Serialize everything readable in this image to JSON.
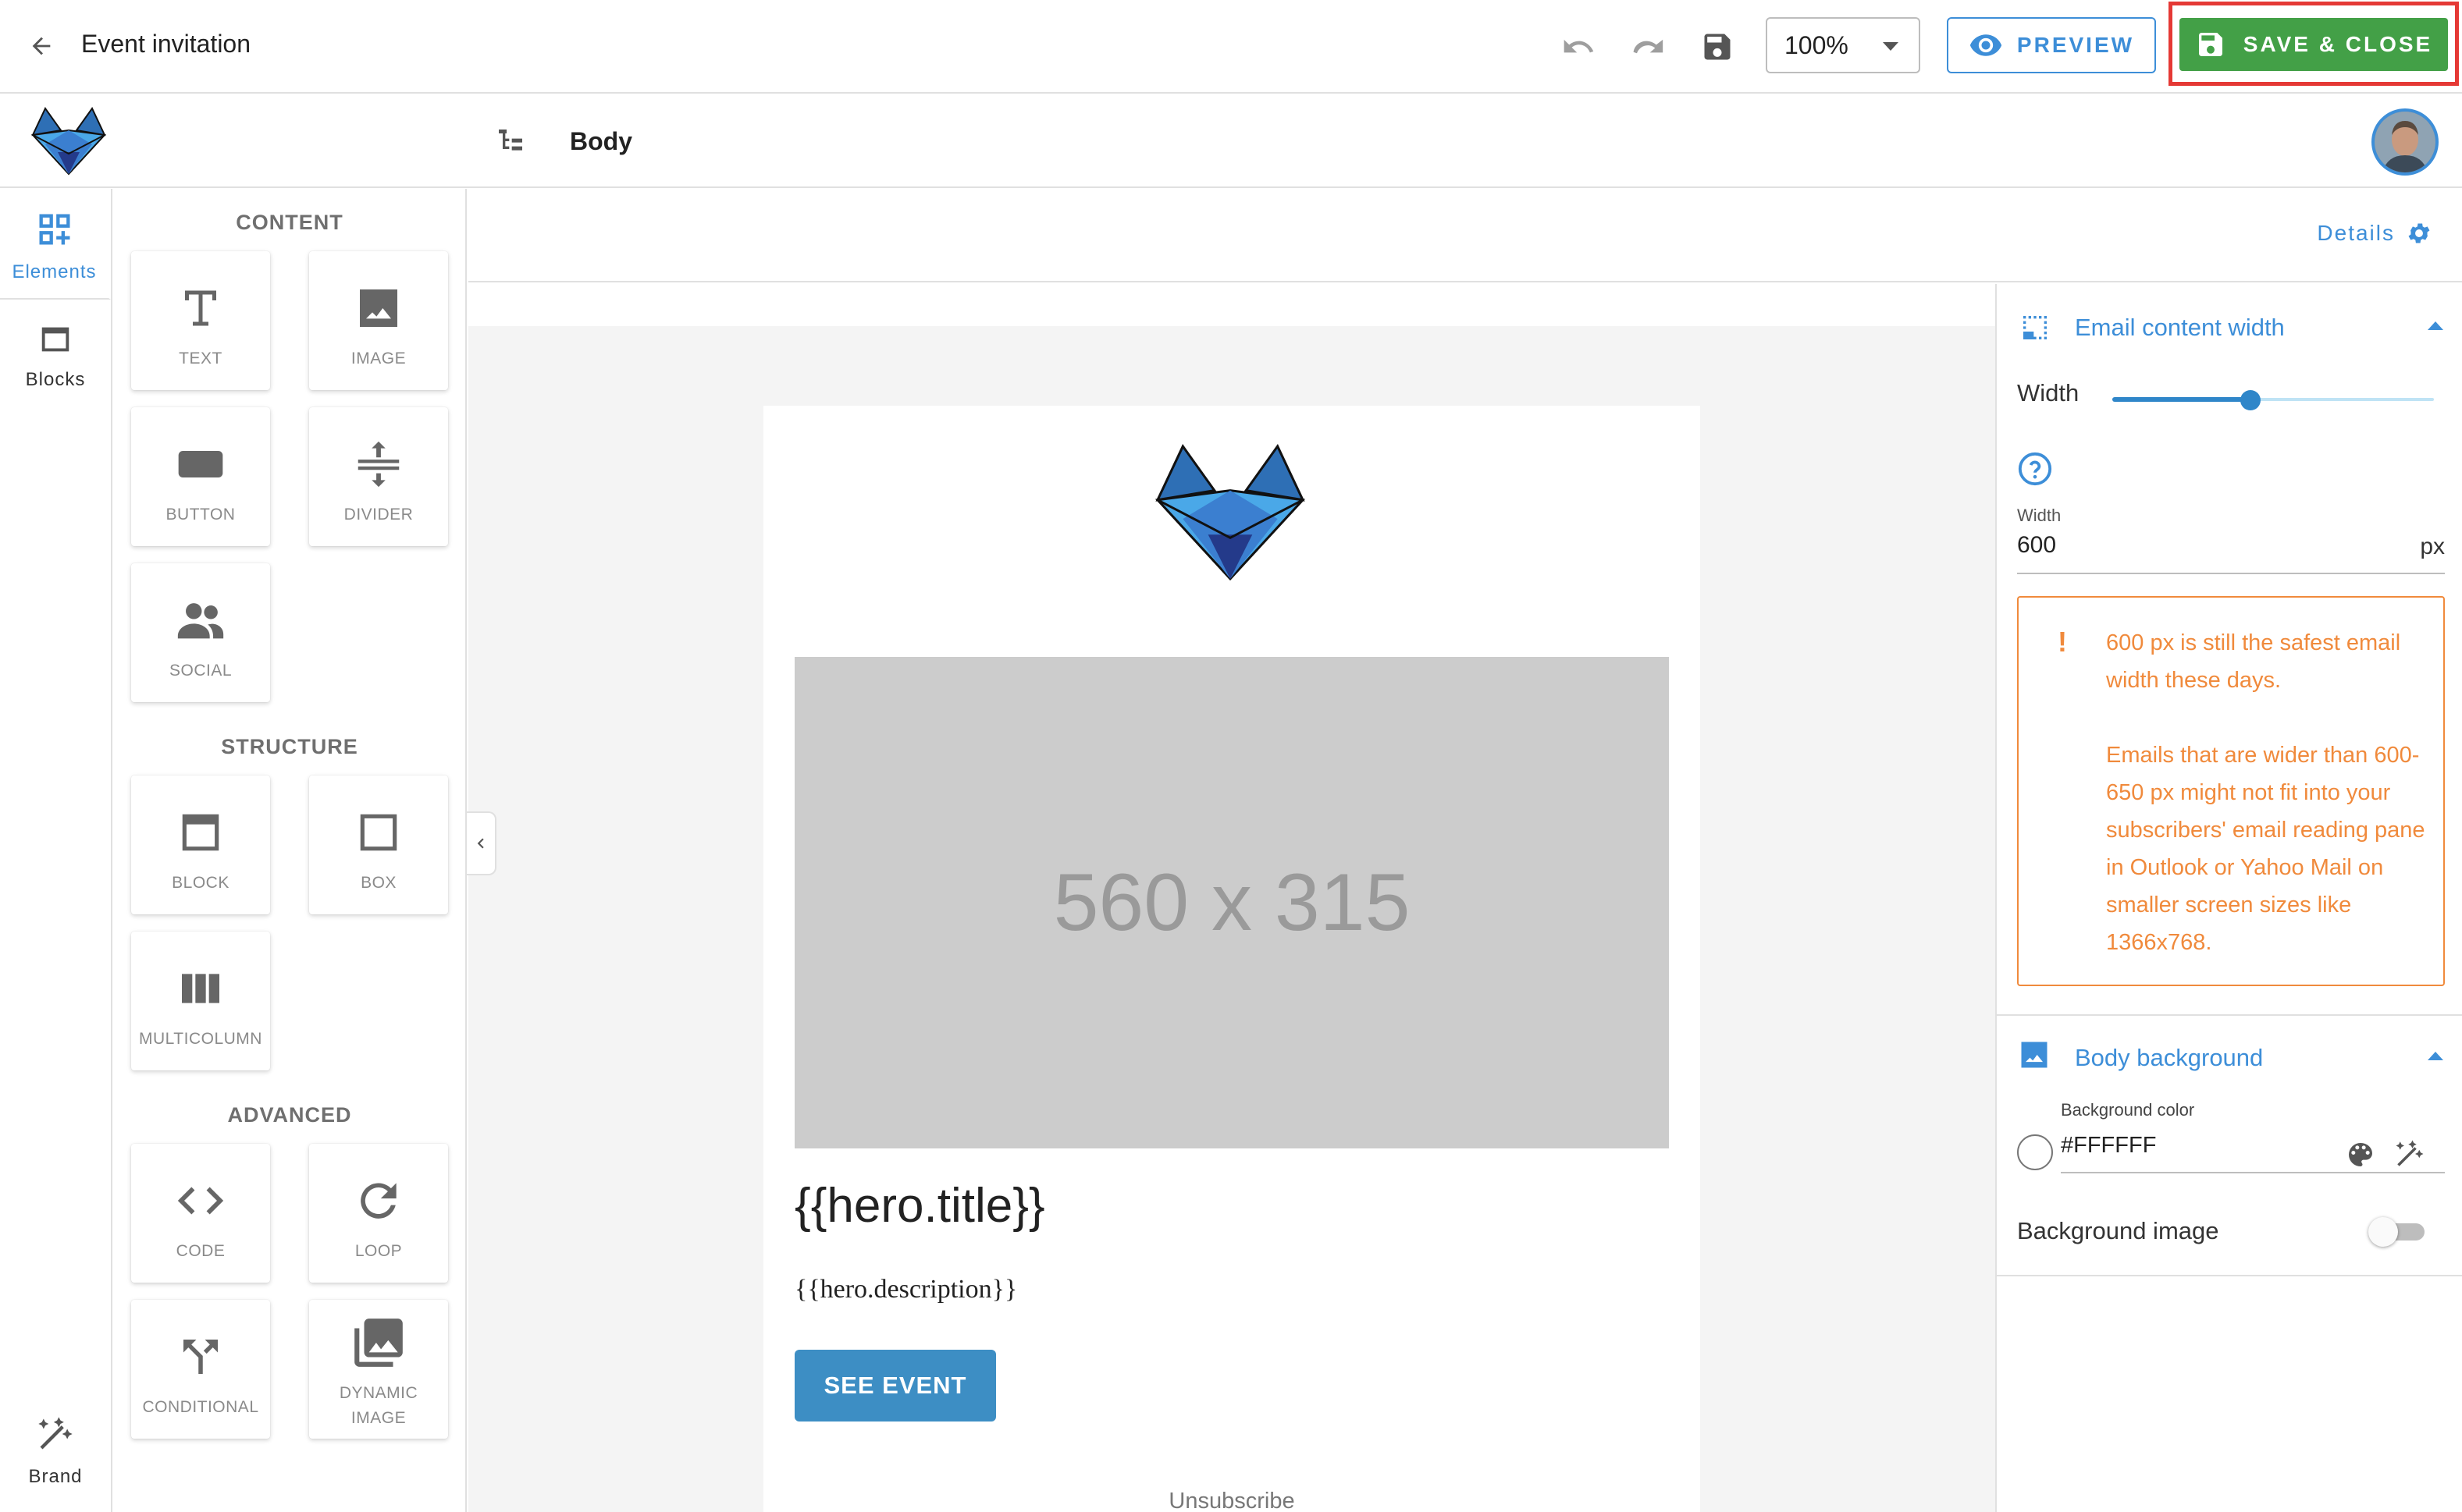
{
  "topbar": {
    "title": "Event invitation",
    "zoom": "100%",
    "preview_label": "PREVIEW",
    "save_close_label": "SAVE & CLOSE",
    "colors": {
      "accent": "#3d8ed8",
      "save": "#43a047",
      "highlight": "#e53935"
    }
  },
  "subbar": {
    "breadcrumb": "Body"
  },
  "rail": {
    "tabs": [
      {
        "label": "Elements",
        "icon": "dashboard-add-icon",
        "active": true
      },
      {
        "label": "Blocks",
        "icon": "block-icon",
        "active": false
      },
      {
        "label": "Brand",
        "icon": "magic-wand-icon",
        "active": false
      }
    ]
  },
  "panel": {
    "sections": [
      {
        "title": "CONTENT",
        "items": [
          "TEXT",
          "IMAGE",
          "BUTTON",
          "DIVIDER",
          "SOCIAL"
        ]
      },
      {
        "title": "STRUCTURE",
        "items": [
          "BLOCK",
          "BOX",
          "MULTICOLUMN"
        ]
      },
      {
        "title": "ADVANCED",
        "items": [
          "CODE",
          "LOOP",
          "CONDITIONAL",
          "DYNAMIC IMAGE"
        ]
      }
    ],
    "dynamic_image_line1": "DYNAMIC",
    "dynamic_image_line2": "IMAGE"
  },
  "canvas": {
    "details_label": "Details",
    "hero_placeholder": "560 x 315",
    "hero_title": "{{hero.title}}",
    "hero_description": "{{hero.description}}",
    "cta_label": "SEE EVENT",
    "unsubscribe": "Unsubscribe"
  },
  "settings": {
    "content_width": {
      "heading": "Email content width",
      "slider_label": "Width",
      "slider_level": 0.43,
      "field_label": "Width",
      "value": "600",
      "unit": "px",
      "warning_line1": "600 px is still the safest email width these days.",
      "warning_line2": "Emails that are wider than 600-650 px might not fit into your subscribers' email reading pane in Outlook or Yahoo Mail on smaller screen sizes like 1366x768."
    },
    "body_background": {
      "heading": "Body background",
      "color_label": "Background color",
      "color_value": "#FFFFFF",
      "image_label": "Background image",
      "image_enabled": false
    }
  }
}
